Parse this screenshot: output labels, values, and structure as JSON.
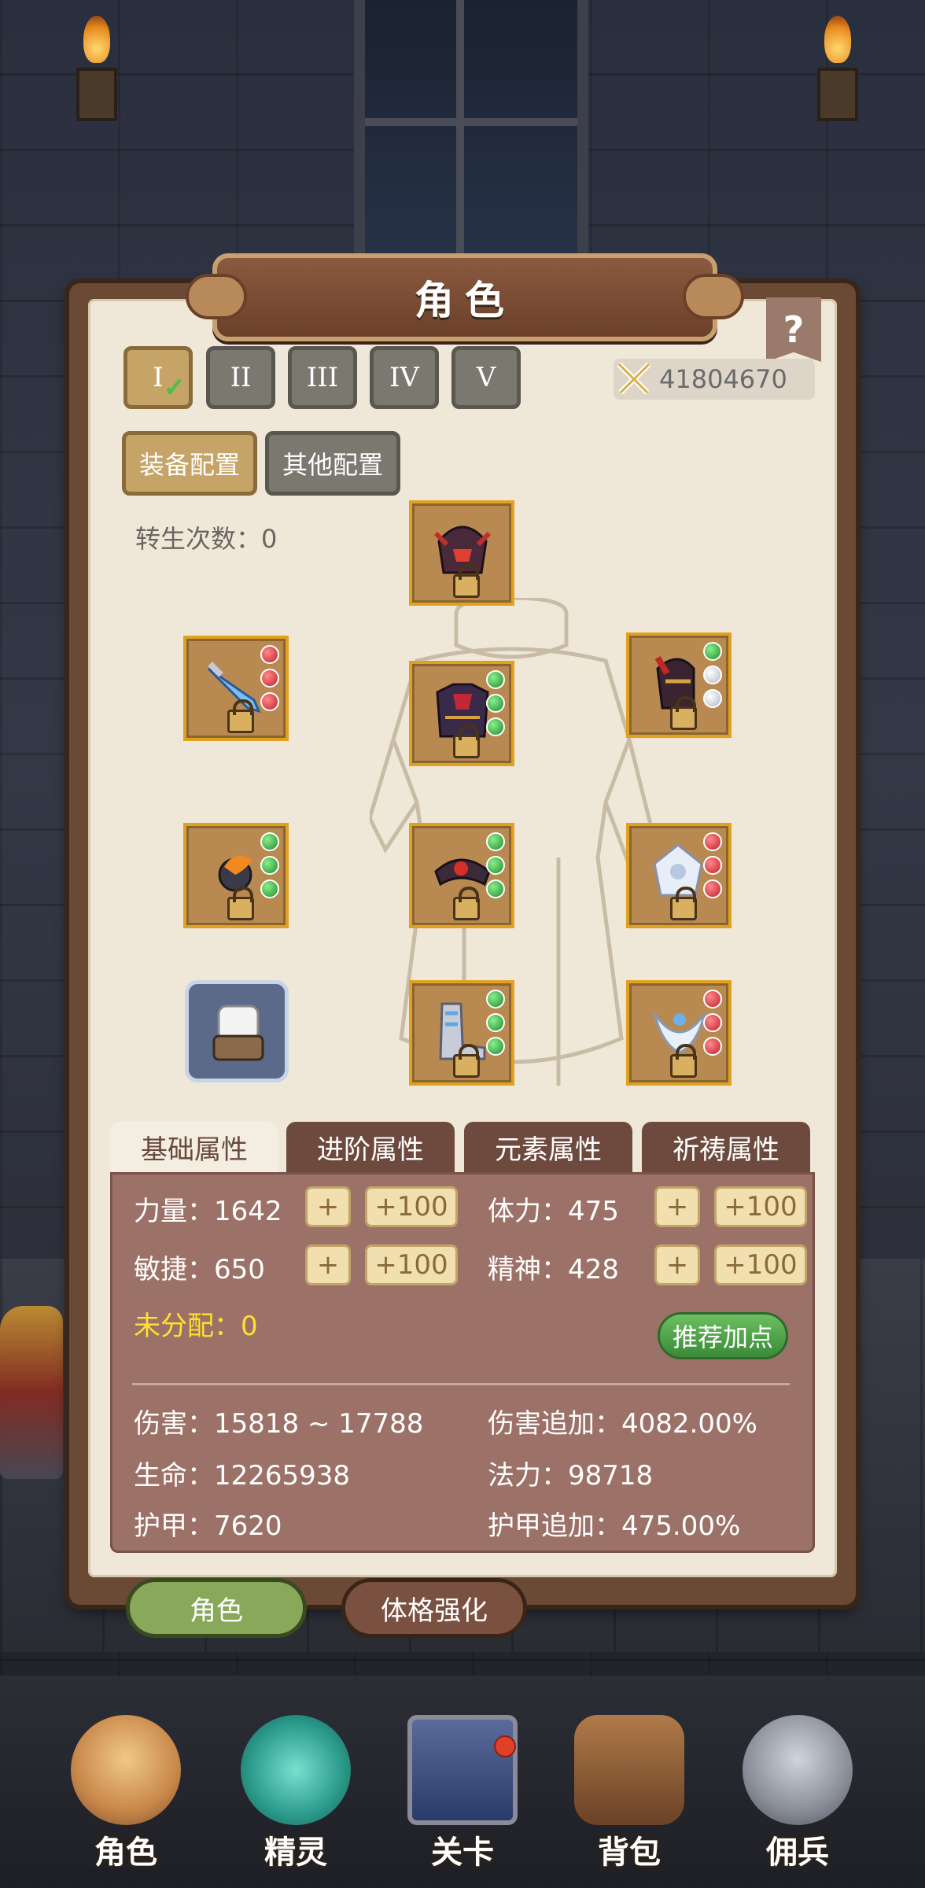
{
  "title": "角色",
  "help_label": "?",
  "rebirth_tabs": [
    {
      "label": "I",
      "active": true,
      "checked": true
    },
    {
      "label": "II",
      "active": false
    },
    {
      "label": "III",
      "active": false
    },
    {
      "label": "IV",
      "active": false
    },
    {
      "label": "V",
      "active": false
    }
  ],
  "power": {
    "value": "41804670",
    "icon": "crossed-swords-icon"
  },
  "config_tabs": {
    "equipment": "装备配置",
    "other": "其他配置"
  },
  "rebirth_count": "转生次数：0",
  "equipment_slots": [
    {
      "name": "helmet",
      "icon": "helmet-icon",
      "gems": []
    },
    {
      "name": "weapon",
      "icon": "sword-icon",
      "gems": [
        "red",
        "red",
        "red"
      ]
    },
    {
      "name": "armor",
      "icon": "chest-armor-icon",
      "gems": [
        "green",
        "green",
        "green"
      ]
    },
    {
      "name": "shoulder",
      "icon": "shoulder-armor-icon",
      "gems": [
        "green",
        "white",
        "white"
      ]
    },
    {
      "name": "amulet",
      "icon": "amulet-icon",
      "gems": [
        "green",
        "green",
        "green"
      ]
    },
    {
      "name": "belt",
      "icon": "belt-icon",
      "gems": [
        "green",
        "green",
        "green"
      ]
    },
    {
      "name": "ring",
      "icon": "ring-icon",
      "gems": [
        "red",
        "red",
        "red"
      ]
    },
    {
      "name": "boots",
      "icon": "boots-icon",
      "gems": [
        "green",
        "green",
        "green"
      ]
    },
    {
      "name": "charm",
      "icon": "charm-icon",
      "gems": [
        "red",
        "red",
        "red"
      ]
    }
  ],
  "attribute_tabs": [
    "基础属性",
    "进阶属性",
    "元素属性",
    "祈祷属性"
  ],
  "base_stats": {
    "strength": "力量：1642",
    "stamina": "体力：475",
    "agility": "敏捷：650",
    "spirit": "精神：428",
    "plus_one": "+",
    "plus_hundred": "+100",
    "unallocated": "未分配：0",
    "recommend": "推荐加点"
  },
  "derived_stats": {
    "damage": "伤害：15818 ~ 17788",
    "damage_bonus": "伤害追加：4082.00%",
    "life": "生命：12265938",
    "mana": "法力：98718",
    "armor": "护甲：7620",
    "armor_bonus": "护甲追加：475.00%"
  },
  "bottom_tabs": {
    "character": "角色",
    "physique": "体格强化"
  },
  "nav": [
    {
      "label": "角色",
      "icon": "hero-portrait-icon"
    },
    {
      "label": "精灵",
      "icon": "slime-spirit-icon"
    },
    {
      "label": "关卡",
      "icon": "stage-gate-icon",
      "badge": true
    },
    {
      "label": "背包",
      "icon": "backpack-icon"
    },
    {
      "label": "佣兵",
      "icon": "knight-helmet-icon"
    }
  ],
  "colors": {
    "accent_gold": "#c6a467",
    "panel_brown": "#9c7268",
    "unallocated_yellow": "#ffe030",
    "recommend_green": "#3a8a38"
  }
}
